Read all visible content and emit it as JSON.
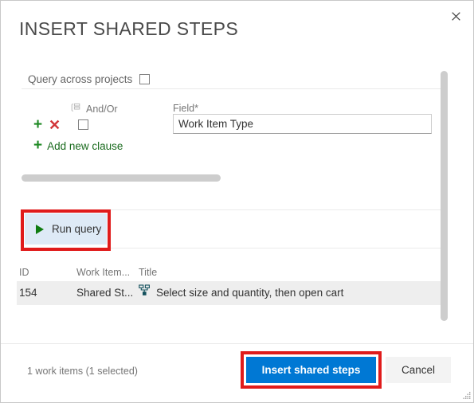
{
  "dialog": {
    "title": "INSERT SHARED STEPS",
    "close_icon": "close-icon"
  },
  "query_builder": {
    "across_projects_label": "Query across projects",
    "across_projects_checked": false,
    "columns": {
      "andor": "And/Or",
      "field": "Field*"
    },
    "andor_group_icon": "list-group-icon",
    "clause": {
      "add_icon": "plus-icon",
      "remove_icon": "remove-x-icon",
      "andor_checked": false,
      "field_value": "Work Item Type",
      "field_placeholder": "Field"
    },
    "add_new_clause_label": "Add new clause",
    "add_new_clause_icon": "plus-icon",
    "run_query_label": "Run query",
    "run_query_icon": "play-triangle-icon"
  },
  "results": {
    "headers": [
      "ID",
      "Work Item...",
      "Title"
    ],
    "rows": [
      {
        "id": "154",
        "work_item_type": "Shared St...",
        "title": "Select size and quantity, then open cart",
        "type_icon": "shared-steps-icon",
        "selected": true
      }
    ]
  },
  "footer": {
    "status": "1 work items (1 selected)",
    "primary_label": "Insert shared steps",
    "secondary_label": "Cancel"
  },
  "colors": {
    "primary_button": "#0078d4",
    "secondary_button": "#f3f3f3",
    "annotation": "#e01b1b",
    "run_query_bg": "#deeaf6",
    "run_icon_green": "#107c10",
    "plus_green": "#1f8a24",
    "remove_red": "#d13438",
    "selected_row": "#eeeeee",
    "shared_steps_icon": "#13505c"
  }
}
